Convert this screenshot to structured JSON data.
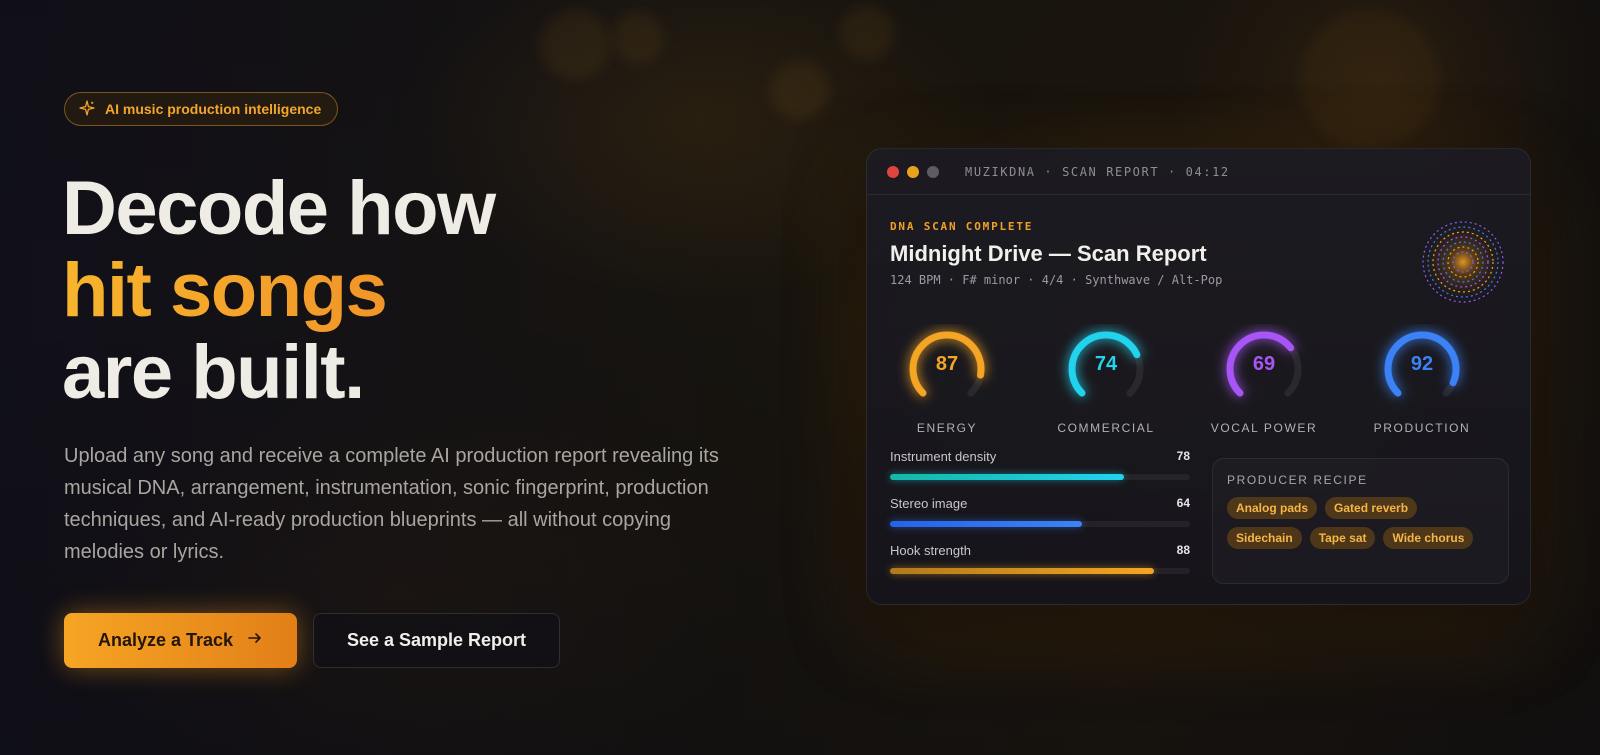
{
  "hero": {
    "badge": "AI music production intelligence",
    "headline_line1": "Decode how",
    "headline_line2": "hit songs",
    "headline_line3": "are built.",
    "description": "Upload any song and receive a complete AI production report revealing its musical DNA, arrangement, instrumentation, sonic fingerprint, production techniques, and AI-ready production blueprints — all without copying melodies or lyrics.",
    "primary_button": "Analyze a Track",
    "secondary_button": "See a Sample Report"
  },
  "report": {
    "window_title": "MUZIKDNA · SCAN REPORT · 04:12",
    "status": "DNA SCAN COMPLETE",
    "title": "Midnight Drive — Scan Report",
    "meta": "124 BPM · F# minor · 4/4 · Synthwave / Alt-Pop",
    "gauges": [
      {
        "label": "ENERGY",
        "value": 87,
        "color": "#f5a524"
      },
      {
        "label": "COMMERCIAL",
        "value": 74,
        "color": "#22d3ee"
      },
      {
        "label": "VOCAL POWER",
        "value": 69,
        "color": "#a855f7"
      },
      {
        "label": "PRODUCTION",
        "value": 92,
        "color": "#3b82f6"
      }
    ],
    "bars": [
      {
        "label": "Instrument density",
        "value": 78,
        "color_from": "#14b8a6",
        "color_to": "#22d3ee"
      },
      {
        "label": "Stereo image",
        "value": 64,
        "color_from": "#2563eb",
        "color_to": "#3b82f6"
      },
      {
        "label": "Hook strength",
        "value": 88,
        "color_from": "#b07a1a",
        "color_to": "#f5a524"
      }
    ],
    "recipe": {
      "title": "PRODUCER RECIPE",
      "tags": [
        "Analog pads",
        "Gated reverb",
        "Sidechain",
        "Tape sat",
        "Wide chorus"
      ]
    }
  },
  "colors": {
    "accent": "#f5a524",
    "window_dot_red": "#e0443e",
    "window_dot_yellow": "#e8a21c",
    "window_dot_gray": "#5d5b63"
  },
  "icons": {
    "badge_icon": "sparkles-icon",
    "primary_button_icon": "arrow-right-icon"
  }
}
